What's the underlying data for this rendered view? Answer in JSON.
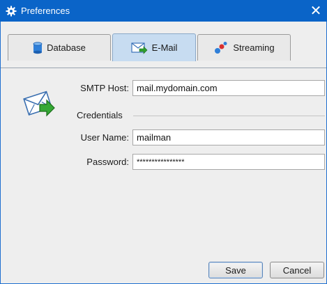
{
  "window": {
    "title": "Preferences",
    "close_glyph": "✕",
    "title_icon": "gear-icon",
    "colors": {
      "titlebar": "#0a64c8",
      "tab_active": "#c7dcf1"
    }
  },
  "tabs": [
    {
      "label": "Database",
      "icon": "database-icon",
      "active": false
    },
    {
      "label": "E-Mail",
      "icon": "mail-icon",
      "active": true
    },
    {
      "label": "Streaming",
      "icon": "streaming-icon",
      "active": false
    }
  ],
  "form": {
    "smtp_host_label": "SMTP Host:",
    "smtp_host_value": "mail.mydomain.com",
    "credentials_label": "Credentials",
    "user_name_label": "User Name:",
    "user_name_value": "mailman",
    "password_label": "Password:",
    "password_value": "****************"
  },
  "buttons": {
    "save_label": "Save",
    "cancel_label": "Cancel"
  }
}
